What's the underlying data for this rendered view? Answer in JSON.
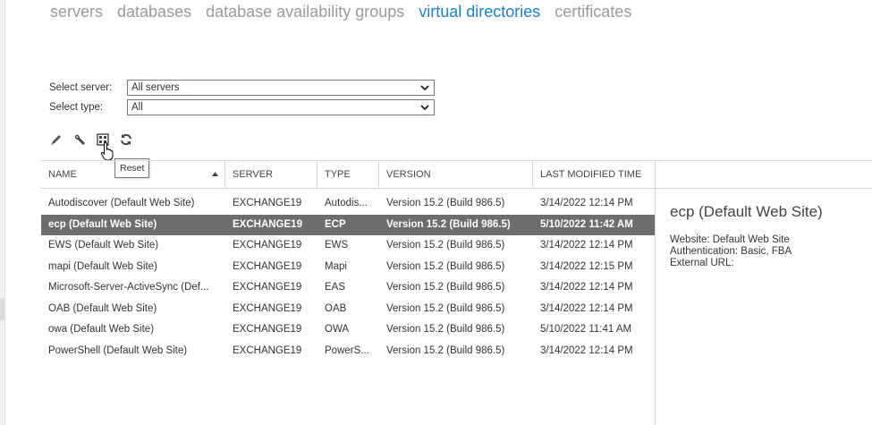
{
  "tabs": [
    {
      "label": "servers",
      "active": false
    },
    {
      "label": "databases",
      "active": false
    },
    {
      "label": "database availability groups",
      "active": false
    },
    {
      "label": "virtual directories",
      "active": true
    },
    {
      "label": "certificates",
      "active": false
    }
  ],
  "filters": {
    "server_label": "Select server:",
    "server_value": "All servers",
    "type_label": "Select type:",
    "type_value": "All"
  },
  "toolbar": {
    "icons": [
      "edit-icon",
      "configure-icon",
      "reset-icon",
      "refresh-icon"
    ],
    "tooltip": "Reset"
  },
  "table": {
    "columns": [
      "NAME",
      "SERVER",
      "TYPE",
      "VERSION",
      "LAST MODIFIED TIME"
    ],
    "sort_column": "NAME",
    "sort_direction": "ascending",
    "rows": [
      {
        "name": "Autodiscover (Default Web Site)",
        "server": "EXCHANGE19",
        "type": "Autodis...",
        "version": "Version 15.2 (Build 986.5)",
        "modified": "3/14/2022 12:14 PM",
        "selected": false
      },
      {
        "name": "ecp (Default Web Site)",
        "server": "EXCHANGE19",
        "type": "ECP",
        "version": "Version 15.2 (Build 986.5)",
        "modified": "5/10/2022 11:42 AM",
        "selected": true
      },
      {
        "name": "EWS (Default Web Site)",
        "server": "EXCHANGE19",
        "type": "EWS",
        "version": "Version 15.2 (Build 986.5)",
        "modified": "3/14/2022 12:14 PM",
        "selected": false
      },
      {
        "name": "mapi (Default Web Site)",
        "server": "EXCHANGE19",
        "type": "Mapi",
        "version": "Version 15.2 (Build 986.5)",
        "modified": "3/14/2022 12:15 PM",
        "selected": false
      },
      {
        "name": "Microsoft-Server-ActiveSync (Def...",
        "server": "EXCHANGE19",
        "type": "EAS",
        "version": "Version 15.2 (Build 986.5)",
        "modified": "3/14/2022 12:14 PM",
        "selected": false
      },
      {
        "name": "OAB (Default Web Site)",
        "server": "EXCHANGE19",
        "type": "OAB",
        "version": "Version 15.2 (Build 986.5)",
        "modified": "3/14/2022 12:14 PM",
        "selected": false
      },
      {
        "name": "owa (Default Web Site)",
        "server": "EXCHANGE19",
        "type": "OWA",
        "version": "Version 15.2 (Build 986.5)",
        "modified": "5/10/2022 11:41 AM",
        "selected": false
      },
      {
        "name": "PowerShell (Default Web Site)",
        "server": "EXCHANGE19",
        "type": "PowerS...",
        "version": "Version 15.2 (Build 986.5)",
        "modified": "3/14/2022 12:14 PM",
        "selected": false
      }
    ]
  },
  "details": {
    "title": "ecp (Default Web Site)",
    "website": "Website: Default Web Site",
    "authentication": "Authentication: Basic, FBA",
    "external_url": "External URL:"
  },
  "colors": {
    "accent": "#1f7fc9",
    "selected_row": "#6d6d6d",
    "inactive_tab": "#9a9a9a"
  }
}
